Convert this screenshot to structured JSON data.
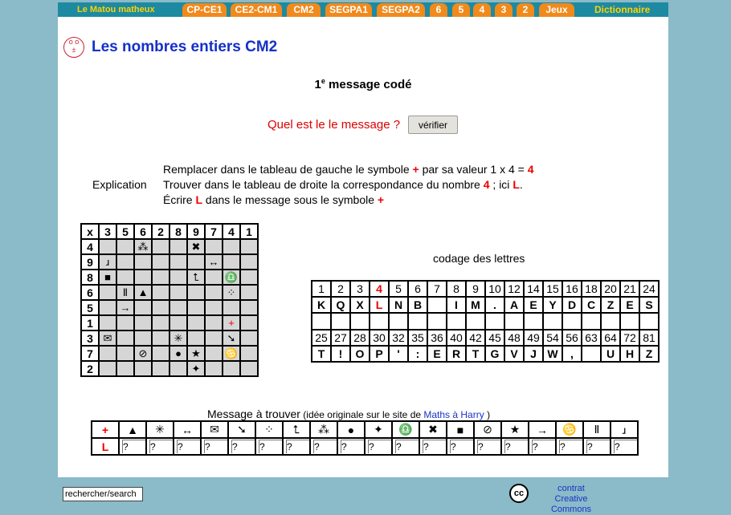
{
  "nav": {
    "brand": "Le Matou matheux",
    "tabs": [
      "CP-CE1",
      "CE2-CM1",
      "CM2",
      "SEGPA1",
      "SEGPA2",
      "6",
      "5",
      "4",
      "3",
      "2",
      "Jeux"
    ],
    "dictionary": "Dictionnaire"
  },
  "page": {
    "logo_icon": "cat-face-icon",
    "title": "Les nombres entiers CM2",
    "subtitle_num": "1",
    "subtitle_sup": "e",
    "subtitle_text": " message codé"
  },
  "question": {
    "label": "Quel est le le message ?",
    "button": "vérifier"
  },
  "explanation": {
    "label": "Explication",
    "l1_a": "Remplacer dans le tableau de gauche le symbole ",
    "l1_sym": "+",
    "l1_b": " par sa valeur 1 x 4 = ",
    "l1_val": "4",
    "l2_a": "Trouver dans le tableau de droite la correspondance du nombre ",
    "l2_num": "4",
    "l2_b": " ; ici ",
    "l2_let": "L",
    "l2_c": ".",
    "l3_a": "Écrire ",
    "l3_let": "L",
    "l3_b": " dans le message sous le symbole ",
    "l3_sym": "+"
  },
  "grid": {
    "header": [
      "x",
      "3",
      "5",
      "6",
      "2",
      "8",
      "9",
      "7",
      "4",
      "1"
    ],
    "rows": [
      {
        "label": "4",
        "cells": [
          "",
          "",
          "⁂",
          "",
          "",
          "✖",
          "",
          "",
          ""
        ]
      },
      {
        "label": "9",
        "cells": [
          "ɹ",
          "",
          "",
          "",
          "",
          "",
          "↔",
          "",
          ""
        ]
      },
      {
        "label": "8",
        "cells": [
          "■",
          "",
          "",
          "",
          "",
          "⮤",
          "",
          "♎",
          ""
        ]
      },
      {
        "label": "6",
        "cells": [
          "",
          "Ⅱ",
          "▲",
          "",
          "",
          "",
          "",
          "⁘",
          ""
        ]
      },
      {
        "label": "5",
        "cells": [
          "",
          "→",
          "",
          "",
          "",
          "",
          "",
          "",
          ""
        ]
      },
      {
        "label": "1",
        "cells": [
          "",
          "",
          "",
          "",
          "",
          "",
          "",
          "+",
          ""
        ]
      },
      {
        "label": "3",
        "cells": [
          "✉",
          "",
          "",
          "",
          "✳",
          "",
          "",
          "➘",
          ""
        ]
      },
      {
        "label": "7",
        "cells": [
          "",
          "",
          "⊘",
          "",
          "●",
          "★",
          "",
          "♋",
          ""
        ]
      },
      {
        "label": "2",
        "cells": [
          "",
          "",
          "",
          "",
          "",
          "✦",
          "",
          "",
          ""
        ]
      }
    ]
  },
  "codage": {
    "label": "codage des lettres",
    "nums1": [
      "1",
      "2",
      "3",
      "4",
      "5",
      "6",
      "7",
      "8",
      "9",
      "10",
      "12",
      "14",
      "15",
      "16",
      "18",
      "20",
      "21",
      "24"
    ],
    "lets1": [
      "K",
      "Q",
      "X",
      "L",
      "N",
      "B",
      "",
      "I",
      "M",
      ".",
      "A",
      "E",
      "Y",
      "D",
      "C",
      "Z",
      "E",
      "S"
    ],
    "nums2": [
      "25",
      "27",
      "28",
      "30",
      "32",
      "35",
      "36",
      "40",
      "42",
      "45",
      "48",
      "49",
      "54",
      "56",
      "63",
      "64",
      "72",
      "81"
    ],
    "lets2": [
      "T",
      "!",
      "O",
      "P",
      "'",
      ":",
      "E",
      "R",
      "T",
      "G",
      "V",
      "J",
      "W",
      ",",
      "",
      "U",
      "H",
      "Z"
    ]
  },
  "message": {
    "label": "Message à trouver",
    "note": " (idée originale sur le site de ",
    "link": "Maths à Harry",
    "note_end": " )",
    "symbols": [
      "+",
      "▲",
      "✳",
      "↔",
      "✉",
      "➘",
      "⁘",
      "⮤",
      "⁂",
      "●",
      "✦",
      "♎",
      "✖",
      "■",
      "⊘",
      "★",
      "→",
      "♋",
      "Ⅱ",
      "ɹ"
    ],
    "first_answer": "L",
    "placeholder": "?"
  },
  "footer": {
    "search_value": "rechercher/search",
    "cc_icon": "creative-commons-icon",
    "cc_line1": "contrat",
    "cc_line2": "Creative Commons"
  },
  "colors": {
    "background": "#8bbac8",
    "nav_bar": "#1d8aa1",
    "tab": "#f08a1c",
    "title": "#1530c8",
    "accent_red": "#e00"
  }
}
